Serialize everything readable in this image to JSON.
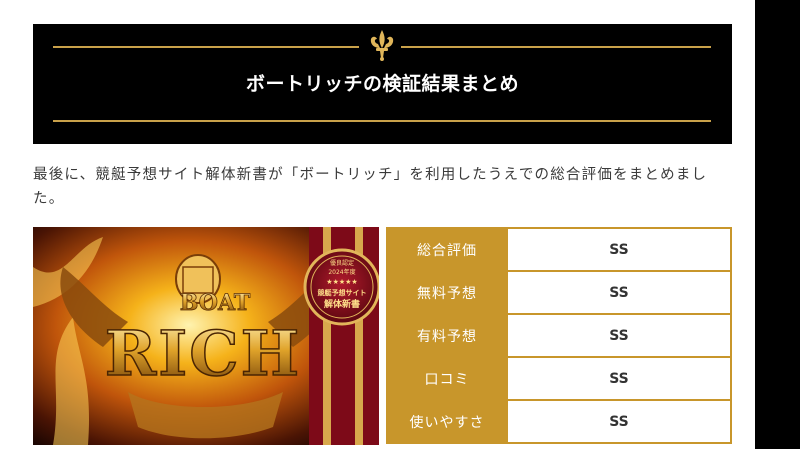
{
  "section": {
    "title": "ボートリッチの検証結果まとめ"
  },
  "intro_text": "最後に、競艇予想サイト解体新書が「ボートリッチ」を利用したうえでの総合評価をまとめました。",
  "banner": {
    "boat_text": "BOAT",
    "rich_text": "RICH",
    "seal_lines": [
      "優良認定",
      "2024年度",
      "★★★★★",
      "競艇予想サイト",
      "解体新書"
    ]
  },
  "ratings": [
    {
      "label": "総合評価",
      "value": "SS"
    },
    {
      "label": "無料予想",
      "value": "SS"
    },
    {
      "label": "有料予想",
      "value": "SS"
    },
    {
      "label": "口コミ",
      "value": "SS"
    },
    {
      "label": "使いやすさ",
      "value": "SS"
    }
  ],
  "colors": {
    "gold": "#c8962b",
    "header_bg": "#000000"
  }
}
